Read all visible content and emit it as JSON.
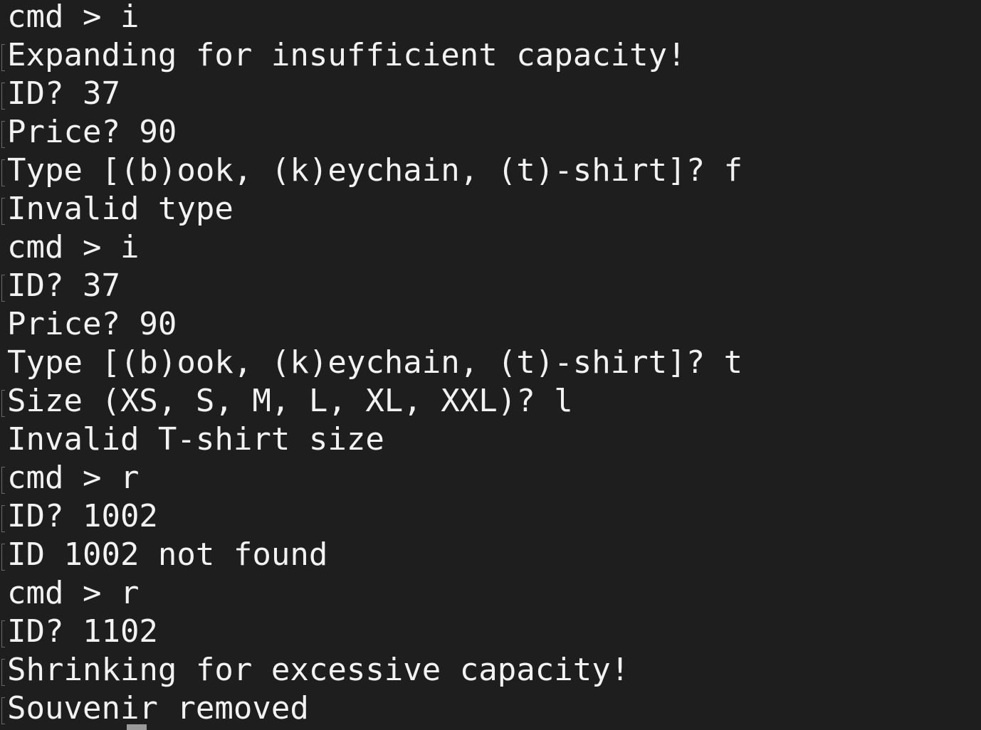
{
  "terminal": {
    "lines": [
      {
        "text": "cmd > i",
        "marked": false
      },
      {
        "text": "Expanding for insufficient capacity!",
        "marked": true
      },
      {
        "text": "ID? 37",
        "marked": true
      },
      {
        "text": "Price? 90",
        "marked": true
      },
      {
        "text": "Type [(b)ook, (k)eychain, (t)-shirt]? f",
        "marked": true
      },
      {
        "text": "Invalid type",
        "marked": true
      },
      {
        "text": "cmd > i",
        "marked": false
      },
      {
        "text": "ID? 37",
        "marked": true
      },
      {
        "text": "Price? 90",
        "marked": false
      },
      {
        "text": "Type [(b)ook, (k)eychain, (t)-shirt]? t",
        "marked": false
      },
      {
        "text": "Size (XS, S, M, L, XL, XXL)? l",
        "marked": true
      },
      {
        "text": "Invalid T-shirt size",
        "marked": false
      },
      {
        "text": "cmd > r",
        "marked": true
      },
      {
        "text": "ID? 1002",
        "marked": true
      },
      {
        "text": "ID 1002 not found",
        "marked": true
      },
      {
        "text": "cmd > r",
        "marked": false
      },
      {
        "text": "ID? 1102",
        "marked": true
      },
      {
        "text": "Shrinking for excessive capacity!",
        "marked": true
      },
      {
        "text": "Souvenir removed",
        "marked": true
      }
    ]
  },
  "colors": {
    "background": "#1e1e1e",
    "foreground": "#f2f2f2",
    "cursor": "#9a9a9a"
  }
}
